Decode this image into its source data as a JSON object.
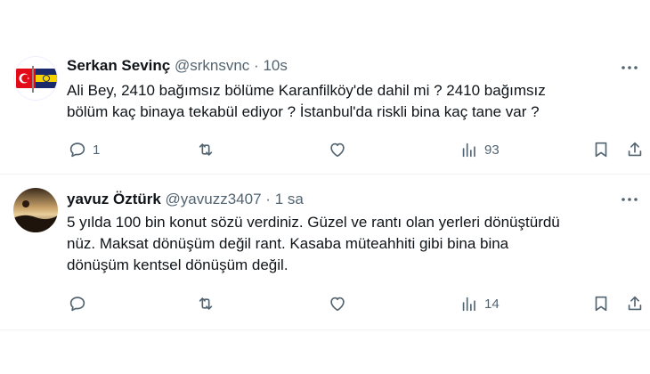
{
  "tweets": [
    {
      "author_name": "Serkan Sevinç",
      "handle": "@srknsvnc",
      "separator": "·",
      "time": "10s",
      "text": "Ali Bey, 2410 bağımsız bölüme Karanfilköy'de dahil mi ? 2410 bağımsız\nbölüm kaç binaya tekabül ediyor ? İstanbul'da riskli bina kaç tane var ?",
      "reply_count": "1",
      "retweet_count": "",
      "like_count": "",
      "view_count": "93"
    },
    {
      "author_name": "yavuz Öztürk",
      "handle": "@yavuzz3407",
      "separator": "·",
      "time": "1 sa",
      "text": "5 yılda 100 bin konut sözü verdiniz. Güzel ve rantı olan yerleri dönüştürdü\nnüz. Maksat dönüşüm değil rant. Kasaba müteahhiti gibi bina bina\ndönüşüm kentsel dönüşüm değil.",
      "reply_count": "",
      "retweet_count": "",
      "like_count": "",
      "view_count": "14"
    }
  ],
  "colors": {
    "text": "#0f1419",
    "secondary": "#536471",
    "divider": "#eff3f4"
  }
}
